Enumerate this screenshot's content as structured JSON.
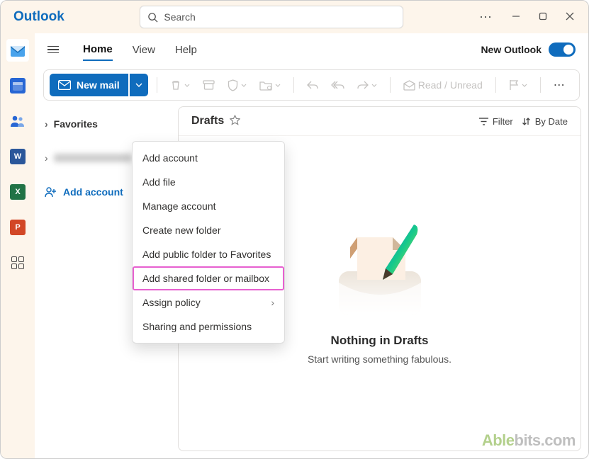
{
  "app": {
    "name": "Outlook"
  },
  "search": {
    "placeholder": "Search"
  },
  "tabs": {
    "home": "Home",
    "view": "View",
    "help": "Help"
  },
  "newOutlook": {
    "label": "New Outlook"
  },
  "cmd": {
    "newmail": "New mail",
    "read_unread": "Read / Unread"
  },
  "folders": {
    "favorites": "Favorites",
    "add_account": "Add account"
  },
  "list": {
    "title": "Drafts",
    "filter": "Filter",
    "bydate": "By Date",
    "empty_title": "Nothing in Drafts",
    "empty_sub": "Start writing something fabulous."
  },
  "ctx": {
    "add_account": "Add account",
    "add_file": "Add file",
    "manage_account": "Manage account",
    "create_new_folder": "Create new folder",
    "add_public_folder": "Add public folder to Favorites",
    "add_shared": "Add shared folder or mailbox",
    "assign_policy": "Assign policy",
    "sharing": "Sharing and permissions"
  },
  "rail": {
    "mail": "mail",
    "calendar": "calendar",
    "people": "people",
    "word": "W",
    "excel": "X",
    "powerpoint": "P"
  },
  "watermark": {
    "a": "Able",
    "b": "bits",
    "c": ".com"
  }
}
